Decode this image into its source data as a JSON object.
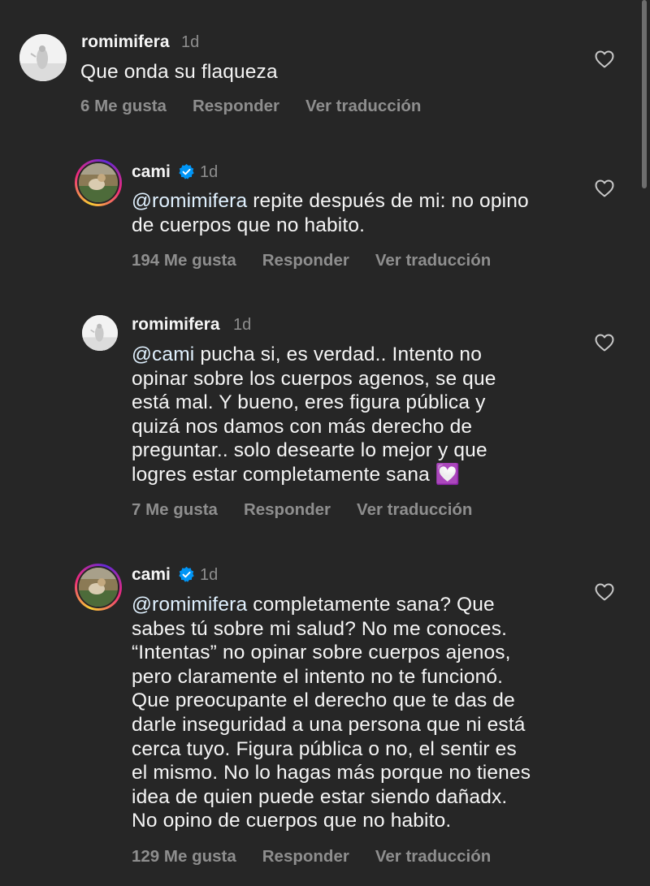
{
  "comments": [
    {
      "username": "romimifera",
      "time": "1d",
      "mention": "",
      "text": "Que onda su flaqueza",
      "likes": "6 Me gusta",
      "reply": "Responder",
      "translate": "Ver traducción",
      "verified": false
    },
    {
      "username": "cami",
      "time": "1d",
      "mention": "@romimifera",
      "text": " repite después de mi: no opino\nde cuerpos que no habito.",
      "likes": "194 Me gusta",
      "reply": "Responder",
      "translate": "Ver traducción",
      "verified": true
    },
    {
      "username": "romimifera",
      "time": "1d",
      "mention": "@cami",
      "text": " pucha si, es verdad.. Intento no\nopinar sobre los cuerpos agenos, se que\nestá mal. Y bueno, eres figura pública y\nquizá nos damos con más derecho de\npreguntar.. solo desearte lo mejor y que\nlogres estar completamente sana",
      "emoji": "💟",
      "likes": "7 Me gusta",
      "reply": "Responder",
      "translate": "Ver traducción",
      "verified": false
    },
    {
      "username": "cami",
      "time": "1d",
      "mention": "@romimifera",
      "text": " completamente sana? Que\nsabes tú sobre mi salud? No me conoces.\n“Intentas” no opinar sobre cuerpos ajenos,\npero claramente el intento no te funcionó.\nQue preocupante el derecho que te das de\ndarle inseguridad a una persona que ni está\ncerca tuyo. Figura pública o no, el sentir es\nel mismo. No lo hagas más porque no tienes\nidea de quien puede estar siendo dañadx.\nNo opino de cuerpos que no habito.",
      "likes": "129 Me gusta",
      "reply": "Responder",
      "translate": "Ver traducción",
      "verified": true
    }
  ],
  "icons": {
    "like": "heart-outline-icon",
    "verified": "verified-badge-icon",
    "emoji": "heart-decoration-emoji"
  },
  "colors": {
    "background": "#262626",
    "text": "#f5f5f5",
    "secondary": "#8e8e8e",
    "mention": "#e0f1ff",
    "verified": "#0095f6"
  }
}
